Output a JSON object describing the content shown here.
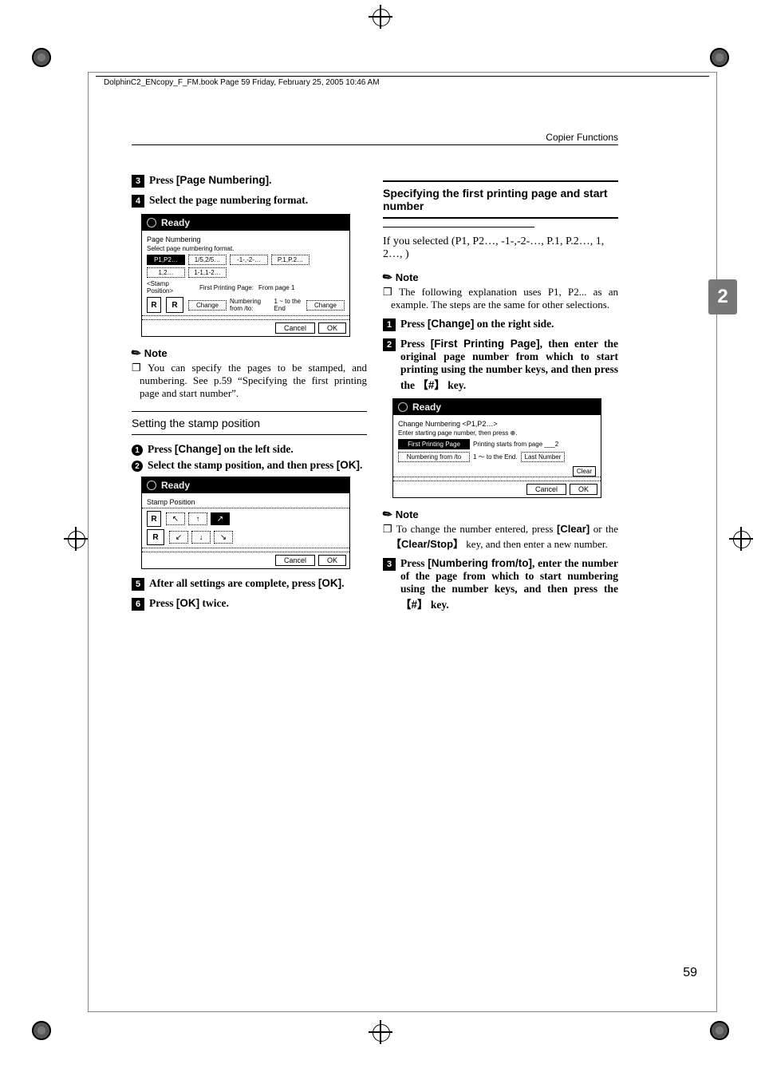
{
  "meta": {
    "bookline": "DolphinC2_ENcopy_F_FM.book  Page 59  Friday, February 25, 2005  10:46 AM",
    "running_head": "Copier Functions",
    "page_number": "59",
    "chapter_tab": "2"
  },
  "left": {
    "step3": {
      "pre": "Press ",
      "btn": "[Page Numbering]",
      "post": "."
    },
    "step4": "Select the page numbering format.",
    "lcd1": {
      "status": "Ready",
      "title": "Page Numbering",
      "subtitle": "Select page numbering format.",
      "row1": [
        "P1,P2…",
        "1/5,2/5…",
        "-1-,-2-…",
        "P.1,P.2…"
      ],
      "row2": [
        "1,2…",
        "1-1,1-2…"
      ],
      "stamp_label": "<Stamp Position>",
      "first_label": "First Printing Page:",
      "first_value": "From page      1",
      "num_label": "Numbering from /to:",
      "num_value": "1 ~ to the End",
      "change": "Change",
      "cancel": "Cancel",
      "ok": "OK"
    },
    "note": "Note",
    "note_body": "You can specify the pages to be stamped, and numbering. See p.59 “Specifying the first printing page and start number”.",
    "subsection": "Setting the stamp position",
    "sub1": {
      "pre": "Press ",
      "btn": "[Change]",
      "post": " on the left side."
    },
    "sub2": {
      "pre": "Select the stamp position, and then press ",
      "btn": "[OK]",
      "post": "."
    },
    "lcd2": {
      "status": "Ready",
      "title": "Stamp Position",
      "cancel": "Cancel",
      "ok": "OK"
    },
    "step5": {
      "pre": "After all settings are complete, press ",
      "btn": "[OK]",
      "post": "."
    },
    "step6": {
      "pre": "Press ",
      "btn": "[OK]",
      "post": " twice."
    }
  },
  "right": {
    "subsection": "Specifying the first printing page and start number",
    "intro": "If you selected (P1, P2…, -1-,-2-…, P.1, P.2…, 1, 2…, )",
    "note": "Note",
    "note_body": "The following explanation uses P1, P2... as an example. The steps are the same for other selections.",
    "stepA": {
      "pre": "Press ",
      "btn": "[Change]",
      "post": " on the right side."
    },
    "stepB_pre": "Press ",
    "stepB_btn": "[First Printing Page]",
    "stepB_mid": ", then enter the original page number from which to start printing using the number keys, and then press the ",
    "stepB_key": "#",
    "stepB_post": " key.",
    "lcd3": {
      "status": "Ready",
      "title": "Change Numbering    <P1,P2…>",
      "subtitle": "Enter starting page number, then press ⊕.",
      "first_btn": "First Printing Page",
      "first_caption": "Printing starts from page ___2",
      "num_btn": "Numbering from /to",
      "num_caption": "1    ～ to the End.",
      "last_btn": "Last Number",
      "clear": "Clear",
      "cancel": "Cancel",
      "ok": "OK"
    },
    "note2": "Note",
    "note2_body_pre": "To change the number entered, press ",
    "note2_clear": "[Clear]",
    "note2_or": " or the ",
    "note2_key": "Clear/Stop",
    "note2_body_post": " key, and then enter a new number.",
    "stepC_pre": "Press ",
    "stepC_btn": "[Numbering from/to]",
    "stepC_mid": ", enter the number of the page from which to start numbering using the number keys, and then press the ",
    "stepC_key": "#",
    "stepC_post": " key."
  }
}
